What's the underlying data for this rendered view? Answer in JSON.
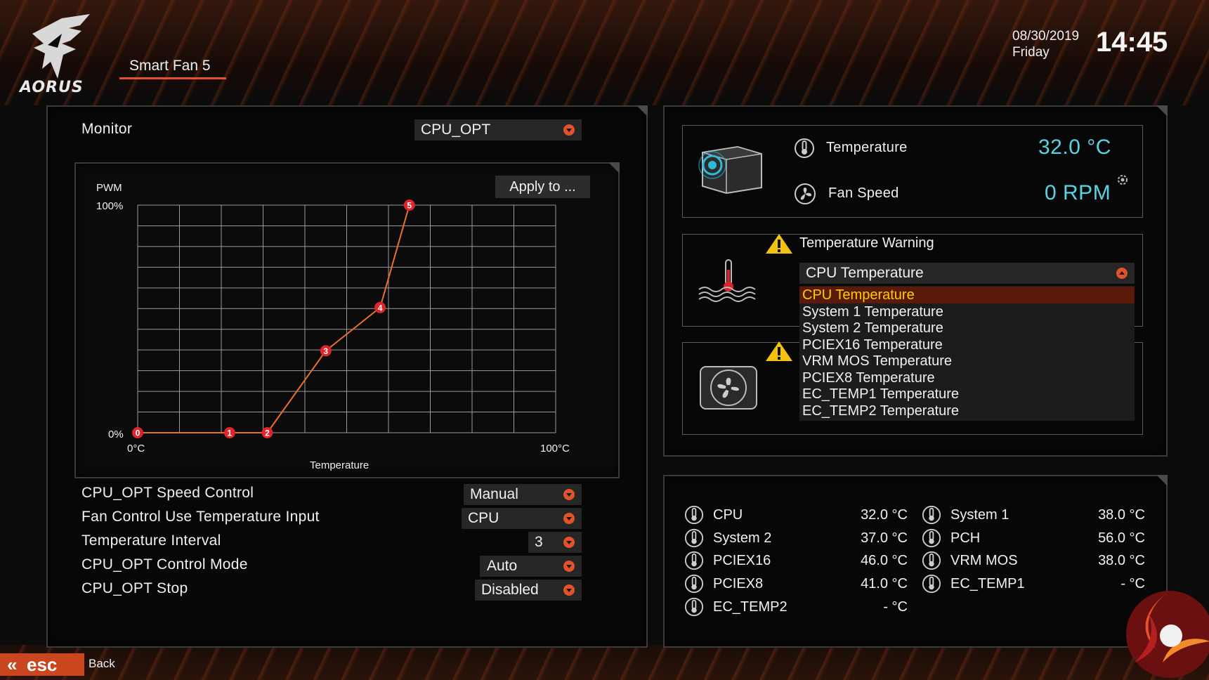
{
  "header": {
    "brand": "AORUS",
    "tab": "Smart Fan 5",
    "date": "08/30/2019",
    "day": "Friday",
    "time": "14:45"
  },
  "left_panel": {
    "monitor_label": "Monitor",
    "monitor_value": "CPU_OPT",
    "apply_button": "Apply to ...",
    "settings": [
      {
        "label": "CPU_OPT Speed Control",
        "value": "Manual"
      },
      {
        "label": "Fan Control Use Temperature Input",
        "value": "CPU"
      },
      {
        "label": "Temperature Interval",
        "value": "3"
      },
      {
        "label": "CPU_OPT Control Mode",
        "value": "Auto"
      },
      {
        "label": "CPU_OPT Stop",
        "value": "Disabled"
      }
    ]
  },
  "chart_data": {
    "type": "line",
    "ylabel": "PWM",
    "xlabel": "Temperature",
    "y_tick_top": "100%",
    "y_tick_bottom": "0%",
    "x_tick_left": "0°C",
    "x_tick_right": "100°C",
    "xlim": [
      0,
      100
    ],
    "ylim": [
      0,
      100
    ],
    "grid": true,
    "series": [
      {
        "points": [
          {
            "label": "0",
            "x": 0,
            "y": 0
          },
          {
            "label": "1",
            "x": 22,
            "y": 0
          },
          {
            "label": "2",
            "x": 31,
            "y": 0
          },
          {
            "label": "3",
            "x": 45,
            "y": 36
          },
          {
            "label": "4",
            "x": 58,
            "y": 55
          },
          {
            "label": "5",
            "x": 65,
            "y": 100
          }
        ]
      }
    ],
    "line_color": "#e8702b",
    "point_color": "#e0242b"
  },
  "status": {
    "temperature_label": "Temperature",
    "temperature_value": "32.0 °C",
    "fan_speed_label": "Fan Speed",
    "fan_speed_value": "0 RPM"
  },
  "warning": {
    "title": "Temperature Warning",
    "selected": "CPU Temperature",
    "options": [
      "CPU Temperature",
      "System 1 Temperature",
      "System 2 Temperature",
      "PCIEX16 Temperature",
      "VRM MOS Temperature",
      "PCIEX8 Temperature",
      "EC_TEMP1 Temperature",
      "EC_TEMP2 Temperature"
    ]
  },
  "temps": [
    {
      "name": "CPU",
      "value": "32.0 °C"
    },
    {
      "name": "System 1",
      "value": "38.0 °C"
    },
    {
      "name": "System 2",
      "value": "37.0 °C"
    },
    {
      "name": "PCH",
      "value": "56.0 °C"
    },
    {
      "name": "PCIEX16",
      "value": "46.0 °C"
    },
    {
      "name": "VRM MOS",
      "value": "38.0 °C"
    },
    {
      "name": "PCIEX8",
      "value": "41.0 °C"
    },
    {
      "name": "EC_TEMP1",
      "value": "- °C"
    },
    {
      "name": "EC_TEMP2",
      "value": "- °C"
    }
  ],
  "footer": {
    "esc_key": "esc",
    "back_label": "Back"
  },
  "colors": {
    "accent": "#e2532b",
    "value_cyan": "#57d4e3",
    "selected_yellow": "#ffcc00"
  }
}
